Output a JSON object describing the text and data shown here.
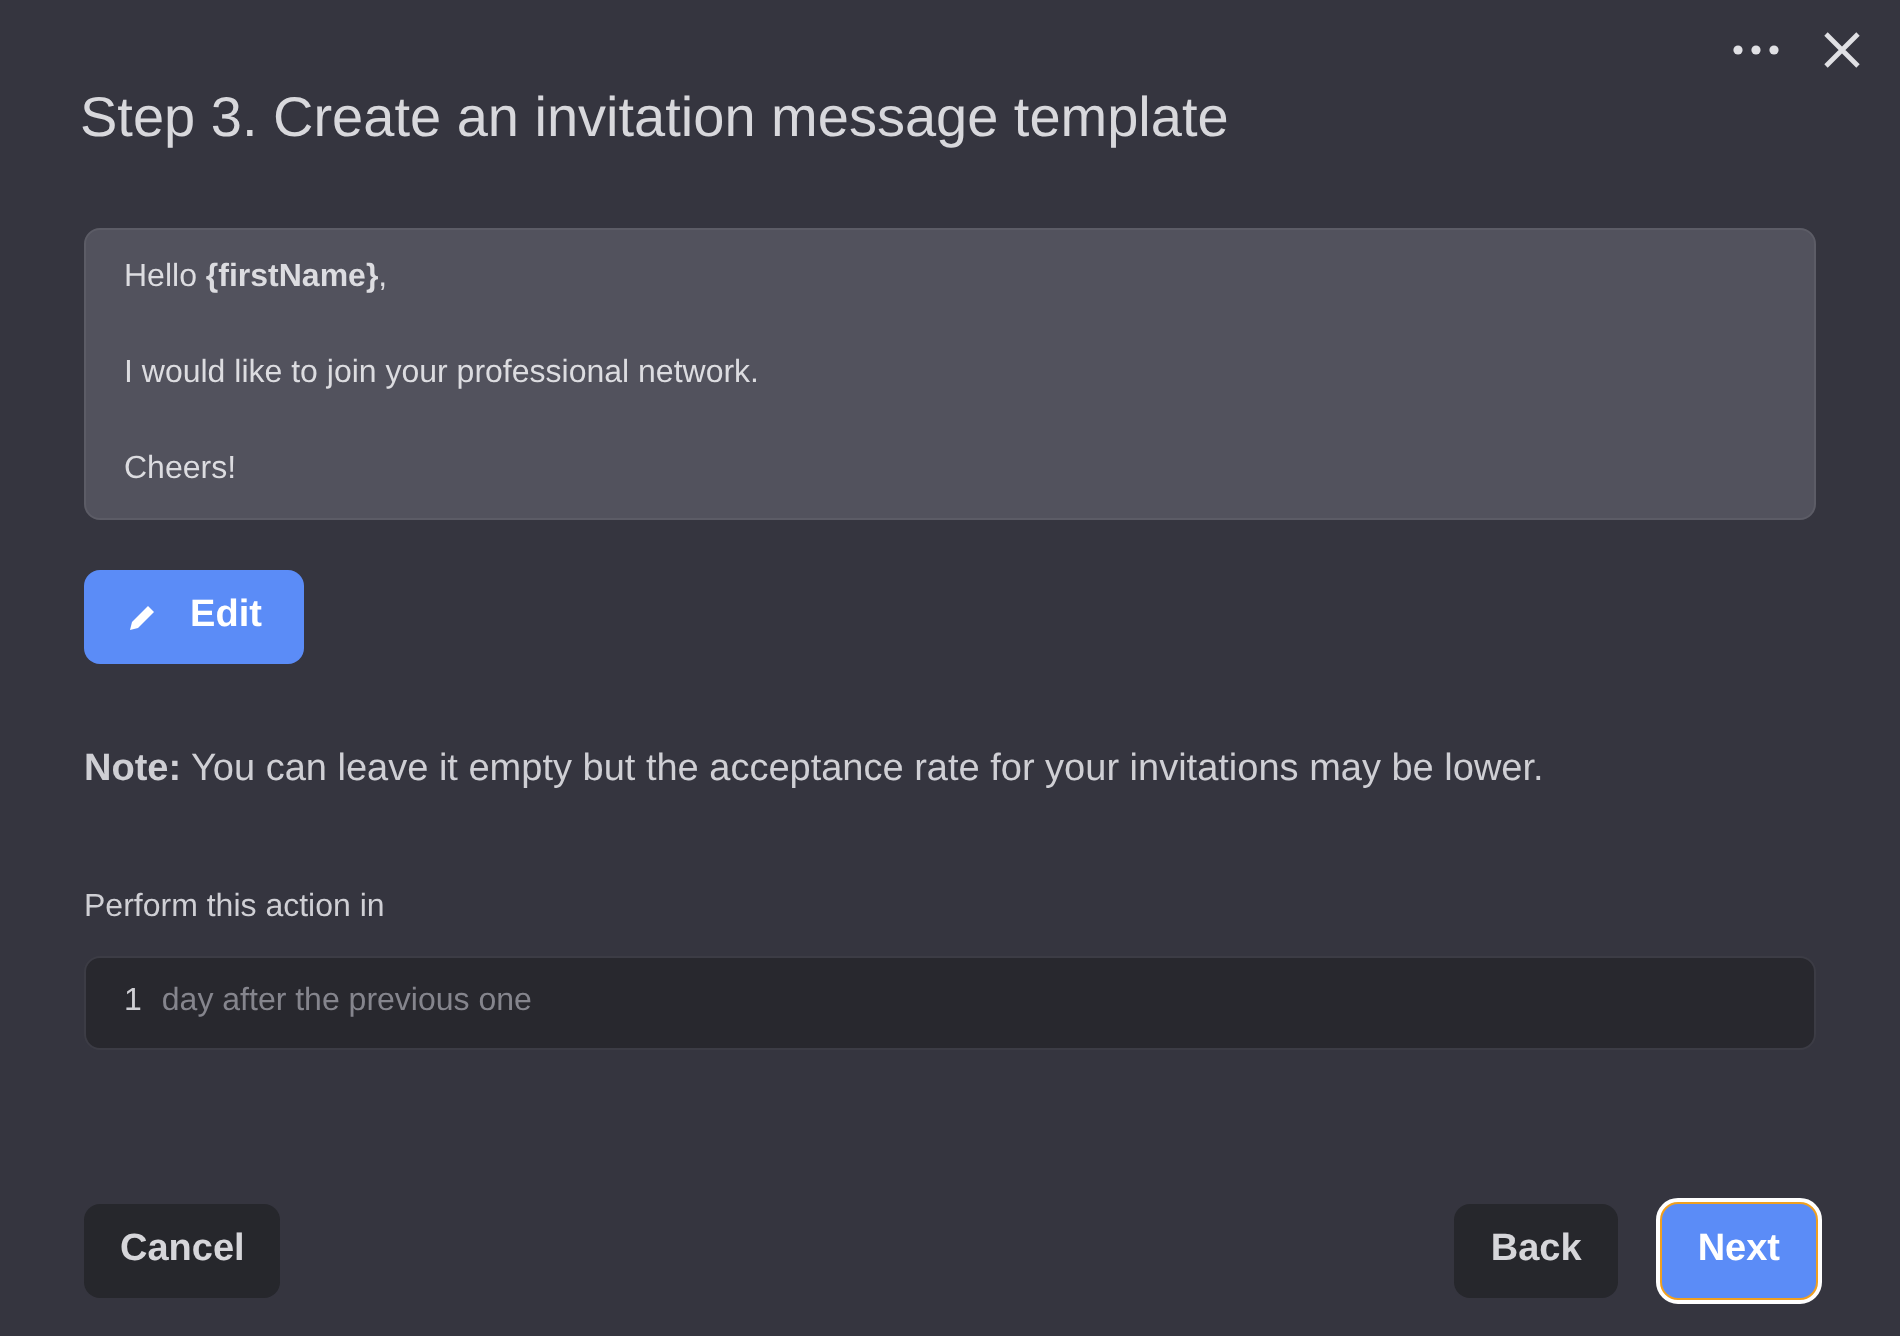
{
  "dialog": {
    "title": "Step 3. Create an invitation message template"
  },
  "message": [
    "Hello **{firstName}**,",
    "I would like to join your professional network.",
    "Cheers!"
  ],
  "edit_button": "Edit",
  "note": "**Note:** You can leave it empty but the acceptance rate for your invitations may be lower.",
  "delay": {
    "label": "Perform this action in",
    "value": "1",
    "suffix": "day after the previous one"
  },
  "buttons": [
    {
      "label": "Cancel",
      "kind": "secondary",
      "focused": false
    },
    {
      "label": "Back",
      "kind": "secondary",
      "focused": false
    },
    {
      "label": "Next",
      "kind": "primary",
      "focused": true
    }
  ]
}
